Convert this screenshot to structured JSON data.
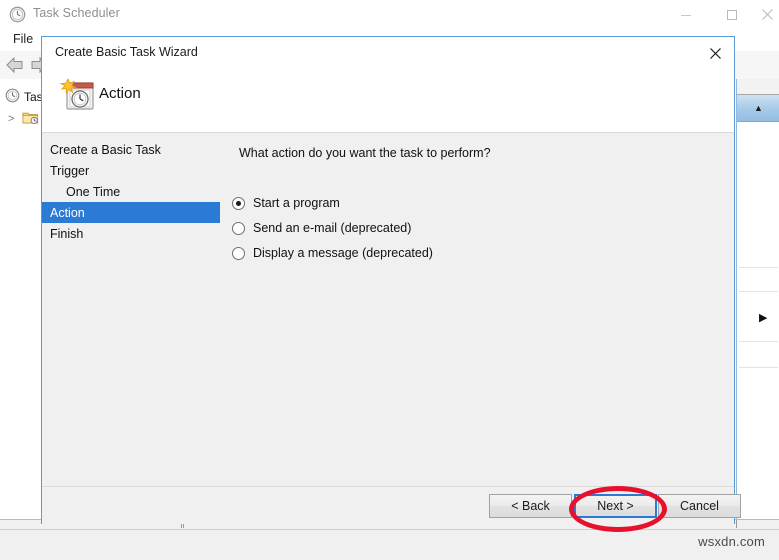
{
  "app": {
    "title": "Task Scheduler",
    "title_icon": "clock-icon",
    "window_controls": {
      "minimize": "minimize-icon",
      "maximize": "maximize-icon",
      "close": "close-icon"
    },
    "menu": {
      "file": "File"
    },
    "toolbar": {
      "back": "back-arrow-icon",
      "forward": "forward-arrow-icon"
    },
    "tree": {
      "root_label": "Tas",
      "root_icon": "clock-icon",
      "child_expander": ">",
      "child_icon": "folder-clock-icon"
    },
    "actions_pane": {
      "collapse_glyph": "▲",
      "submenu_glyph": "▶"
    },
    "watermark": "wsxdn.com"
  },
  "wizard": {
    "window_title": "Create Basic Task Wizard",
    "close_icon": "close-icon",
    "header": {
      "icon": "task-calendar-clock-icon",
      "title": "Action"
    },
    "nav": {
      "items": [
        {
          "label": "Create a Basic Task",
          "indent": false,
          "selected": false
        },
        {
          "label": "Trigger",
          "indent": false,
          "selected": false
        },
        {
          "label": "One Time",
          "indent": true,
          "selected": false
        },
        {
          "label": "Action",
          "indent": false,
          "selected": true
        },
        {
          "label": "Finish",
          "indent": false,
          "selected": false
        }
      ],
      "selected_bg": "#2a7ad6"
    },
    "content": {
      "question": "What action do you want the task to perform?",
      "options": [
        {
          "label": "Start a program",
          "checked": true
        },
        {
          "label": "Send an e-mail (deprecated)",
          "checked": false
        },
        {
          "label": "Display a message (deprecated)",
          "checked": false
        }
      ]
    },
    "buttons": {
      "back": "< Back",
      "next": "Next >",
      "cancel": "Cancel"
    },
    "annotation": {
      "target": "Next >",
      "color": "#e8112d",
      "shape": "oval"
    }
  }
}
